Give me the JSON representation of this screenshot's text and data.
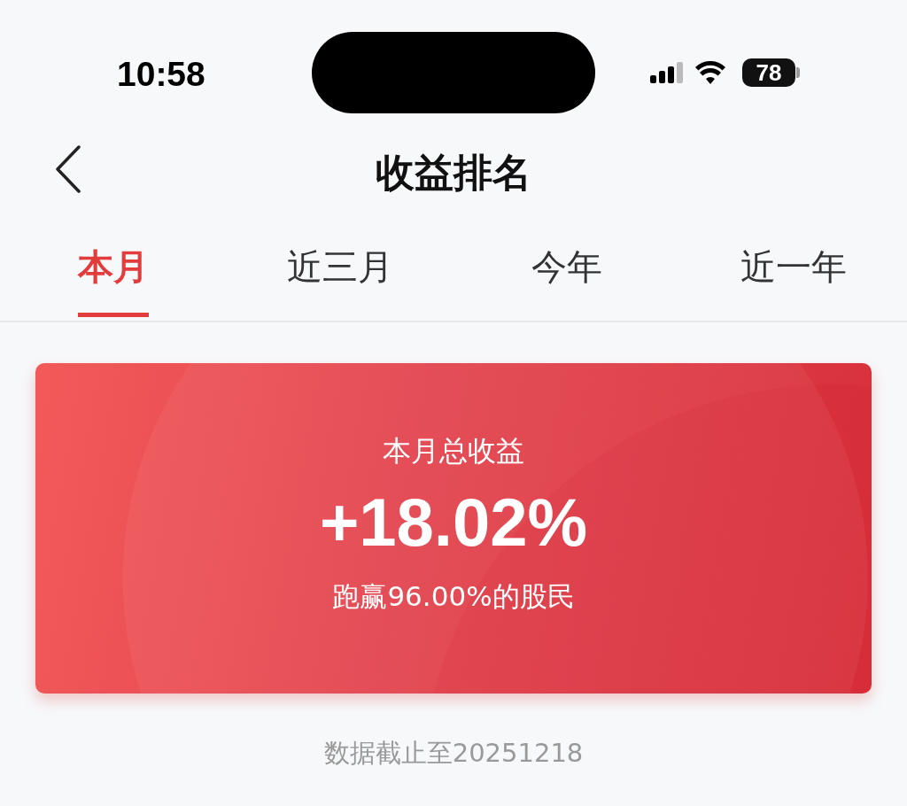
{
  "status_bar": {
    "time": "10:58",
    "battery": "78"
  },
  "nav": {
    "title": "收益排名"
  },
  "tabs": [
    {
      "label": "本月",
      "selected": true
    },
    {
      "label": "近三月",
      "selected": false
    },
    {
      "label": "今年",
      "selected": false
    },
    {
      "label": "近一年",
      "selected": false
    }
  ],
  "summary_card": {
    "label": "本月总收益",
    "value": "+18.02%",
    "comparison": "跑赢96.00%的股民"
  },
  "footer": "数据截止至20251218"
}
